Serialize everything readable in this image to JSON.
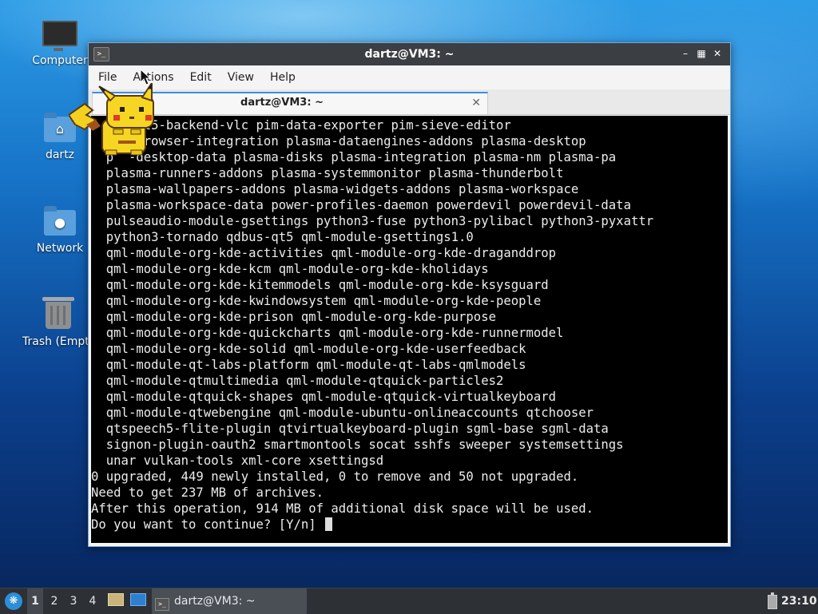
{
  "desktop": {
    "icons": [
      {
        "label": "Computer",
        "icon": "computer-icon"
      },
      {
        "label": "dartz",
        "icon": "home-folder-icon"
      },
      {
        "label": "Network",
        "icon": "network-folder-icon"
      },
      {
        "label": "Trash (Empty)",
        "icon": "trash-icon"
      }
    ]
  },
  "window": {
    "title": "dartz@VM3: ~",
    "controls": [
      "minimize",
      "maximize",
      "close"
    ],
    "menu": [
      "File",
      "Actions",
      "Edit",
      "View",
      "Help"
    ],
    "tab": {
      "label": "dartz@VM3: ~"
    }
  },
  "terminal": {
    "lines": [
      "  p  4qt5-backend-vlc pim-data-exporter pim-sieve-editor",
      "  p  -browser-integration plasma-dataengines-addons plasma-desktop",
      "  p  -desktop-data plasma-disks plasma-integration plasma-nm plasma-pa",
      "  plasma-runners-addons plasma-systemmonitor plasma-thunderbolt",
      "  plasma-wallpapers-addons plasma-widgets-addons plasma-workspace",
      "  plasma-workspace-data power-profiles-daemon powerdevil powerdevil-data",
      "  pulseaudio-module-gsettings python3-fuse python3-pylibacl python3-pyxattr",
      "  python3-tornado qdbus-qt5 qml-module-gsettings1.0",
      "  qml-module-org-kde-activities qml-module-org-kde-draganddrop",
      "  qml-module-org-kde-kcm qml-module-org-kde-kholidays",
      "  qml-module-org-kde-kitemmodels qml-module-org-kde-ksysguard",
      "  qml-module-org-kde-kwindowsystem qml-module-org-kde-people",
      "  qml-module-org-kde-prison qml-module-org-kde-purpose",
      "  qml-module-org-kde-quickcharts qml-module-org-kde-runnermodel",
      "  qml-module-org-kde-solid qml-module-org-kde-userfeedback",
      "  qml-module-qt-labs-platform qml-module-qt-labs-qmlmodels",
      "  qml-module-qtmultimedia qml-module-qtquick-particles2",
      "  qml-module-qtquick-shapes qml-module-qtquick-virtualkeyboard",
      "  qml-module-qtwebengine qml-module-ubuntu-onlineaccounts qtchooser",
      "  qtspeech5-flite-plugin qtvirtualkeyboard-plugin sgml-base sgml-data",
      "  signon-plugin-oauth2 smartmontools socat sshfs sweeper systemsettings",
      "  unar vulkan-tools xml-core xsettingsd",
      "0 upgraded, 449 newly installed, 0 to remove and 50 not upgraded.",
      "Need to get 237 MB of archives.",
      "After this operation, 914 MB of additional disk space will be used."
    ],
    "prompt": "Do you want to continue? [Y/n] "
  },
  "taskbar": {
    "workspaces": [
      "1",
      "2",
      "3",
      "4"
    ],
    "active_workspace": "1",
    "task_label": "dartz@VM3: ~",
    "clock": "23:10"
  },
  "colors": {
    "accent": "#3d8ee0",
    "window_border": "#7aa7d8",
    "terminal_bg": "#000000",
    "terminal_fg": "#ececec",
    "taskbar_bg": "#2d3035"
  }
}
